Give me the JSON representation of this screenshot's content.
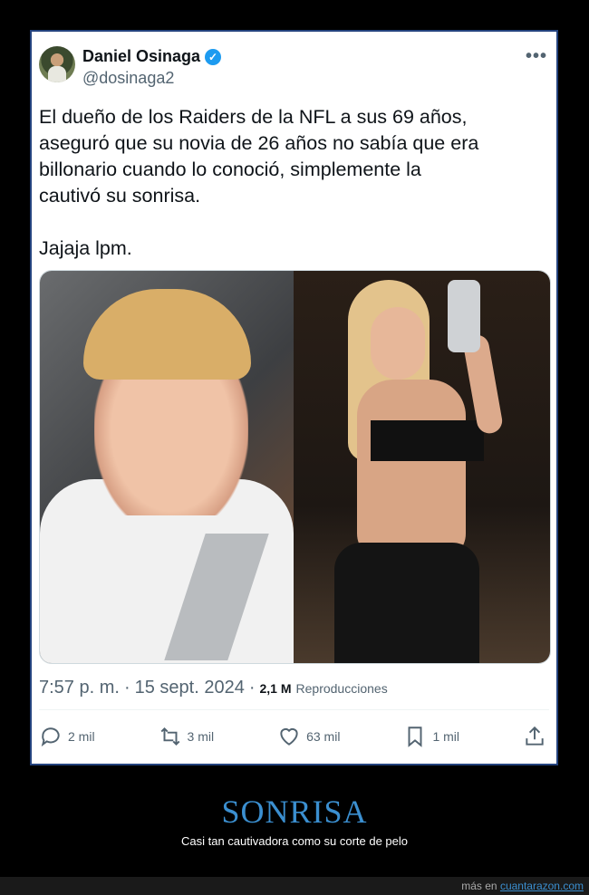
{
  "tweet": {
    "author_name": "Daniel Osinaga",
    "author_handle": "@dosinaga2",
    "more_icon": "more-icon",
    "text": "El dueño de los Raiders de la NFL a sus 69 años,\nasegurό que su novia de 26 años no sabía que era\nbillonario cuando lo conoció, simplemente la\ncautivó su sonrisa.\n\nJajaja lpm.",
    "time": "7:57 p. m.",
    "date": "15 sept. 2024",
    "views_count": "2,1 M",
    "views_label": "Reproducciones",
    "actions": {
      "replies": "2 mil",
      "retweets": "3 mil",
      "likes": "63 mil",
      "bookmarks": "1 mil"
    },
    "colors": {
      "verified": "#1d9bf0",
      "border": "#24437e"
    }
  },
  "footer": {
    "title": "SONRISA",
    "subtitle": "Casi tan cautivadora como su corte de pelo",
    "credit_prefix": "más en",
    "credit_link": "cuantarazon.com"
  }
}
